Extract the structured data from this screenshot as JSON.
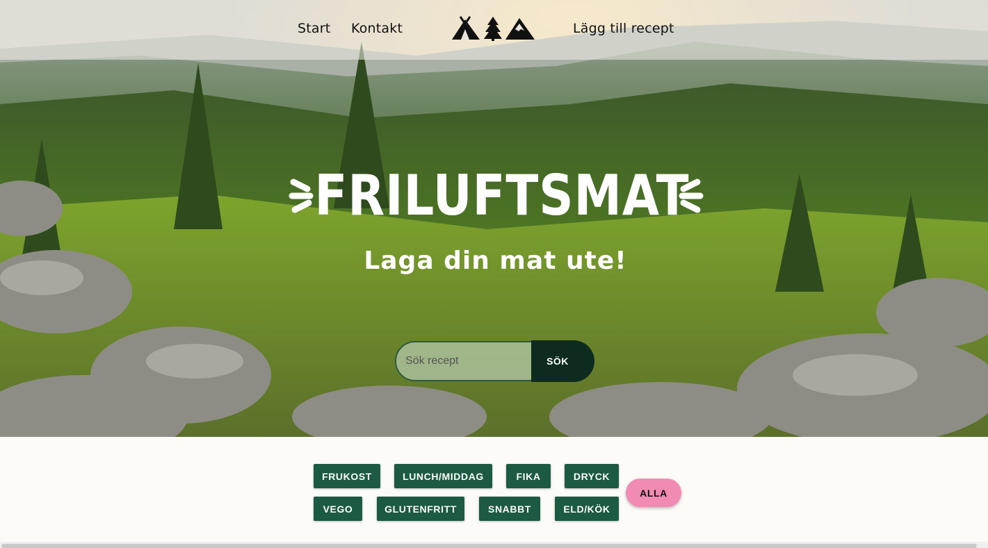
{
  "nav": {
    "start": "Start",
    "kontakt": "Kontakt",
    "add_recipe": "Lägg till recept",
    "logo_icons": [
      "tent-icon",
      "tree-icon",
      "mountain-icon"
    ]
  },
  "hero": {
    "title": "FRILUFTSMAT",
    "subtitle": "Laga din mat ute!"
  },
  "search": {
    "placeholder": "Sök recept",
    "button": "SÖK"
  },
  "filters": {
    "row1": [
      "FRUKOST",
      "LUNCH/MIDDAG",
      "FIKA",
      "DRYCK"
    ],
    "row2": [
      "VEGO",
      "GLUTENFRITT",
      "SNABBT",
      "ELD/KÖK"
    ],
    "all": "ALLA"
  },
  "colors": {
    "filter_bg": "#1c5a43",
    "search_button_bg": "#0d2b1f",
    "all_button_bg": "#f28bb4",
    "page_bg": "#fcfbf8"
  }
}
